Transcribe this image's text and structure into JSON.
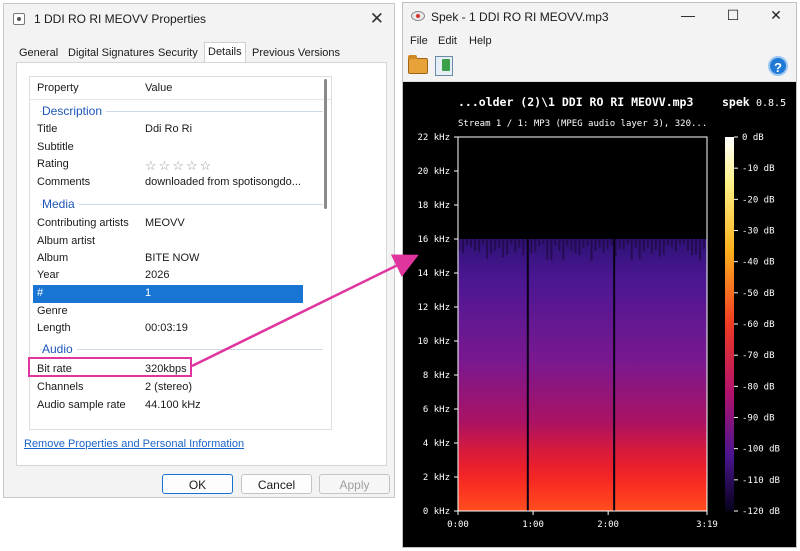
{
  "properties_dialog": {
    "title": "1 DDI RO RI MEOVV Properties",
    "close_glyph": "✕",
    "tabs": [
      "General",
      "Digital Signatures",
      "Security",
      "Details",
      "Previous Versions"
    ],
    "active_tab": "Details",
    "columns": {
      "property": "Property",
      "value": "Value"
    },
    "sections": {
      "description": "Description",
      "media": "Media",
      "audio": "Audio"
    },
    "rows": {
      "title": {
        "p": "Title",
        "v": "Ddi Ro Ri"
      },
      "subtitle": {
        "p": "Subtitle",
        "v": ""
      },
      "rating": {
        "p": "Rating",
        "v": "☆☆☆☆☆"
      },
      "comments": {
        "p": "Comments",
        "v": "downloaded from spotisongdo..."
      },
      "contributing_artists": {
        "p": "Contributing artists",
        "v": "MEOVV"
      },
      "album_artist": {
        "p": "Album artist",
        "v": ""
      },
      "album": {
        "p": "Album",
        "v": "BITE NOW"
      },
      "year": {
        "p": "Year",
        "v": "2026"
      },
      "track": {
        "p": "#",
        "v": "1"
      },
      "genre": {
        "p": "Genre",
        "v": ""
      },
      "length": {
        "p": "Length",
        "v": "00:03:19"
      },
      "bit_rate": {
        "p": "Bit rate",
        "v": "320kbps"
      },
      "channels": {
        "p": "Channels",
        "v": "2 (stereo)"
      },
      "sample_rate": {
        "p": "Audio sample rate",
        "v": "44.100 kHz"
      }
    },
    "remove_link": "Remove Properties and Personal Information",
    "buttons": {
      "ok": "OK",
      "cancel": "Cancel",
      "apply": "Apply"
    }
  },
  "spek": {
    "title": "Spek - 1 DDI RO RI MEOVV.mp3",
    "window_buttons": {
      "minimize": "—",
      "maximize": "☐",
      "close": "✕"
    },
    "menu": [
      "File",
      "Edit",
      "Help"
    ],
    "help_glyph": "?",
    "header_file": "...older (2)\\1 DDI RO RI MEOVV.mp3",
    "app_name": "spek",
    "app_version": "0.8.5",
    "stream_info": "Stream 1 / 1: MP3 (MPEG audio layer 3), 320...",
    "freq_labels": [
      "22 kHz",
      "20 kHz",
      "18 kHz",
      "16 kHz",
      "14 kHz",
      "12 kHz",
      "10 kHz",
      "8 kHz",
      "6 kHz",
      "4 kHz",
      "2 kHz",
      "0 kHz"
    ],
    "time_labels": [
      "0:00",
      "1:00",
      "2:00",
      "3:19"
    ],
    "db_labels": [
      "0 dB",
      "-10 dB",
      "-20 dB",
      "-30 dB",
      "-40 dB",
      "-50 dB",
      "-60 dB",
      "-70 dB",
      "-80 dB",
      "-90 dB",
      "-100 dB",
      "-110 dB",
      "-120 dB"
    ],
    "spectrogram": {
      "cutoff_khz": 16,
      "max_khz": 22,
      "duration_s": 199,
      "dark_lines_s": [
        55,
        124
      ]
    }
  },
  "colors": {
    "accent": "#1875d3",
    "highlight": "#e0359f"
  }
}
